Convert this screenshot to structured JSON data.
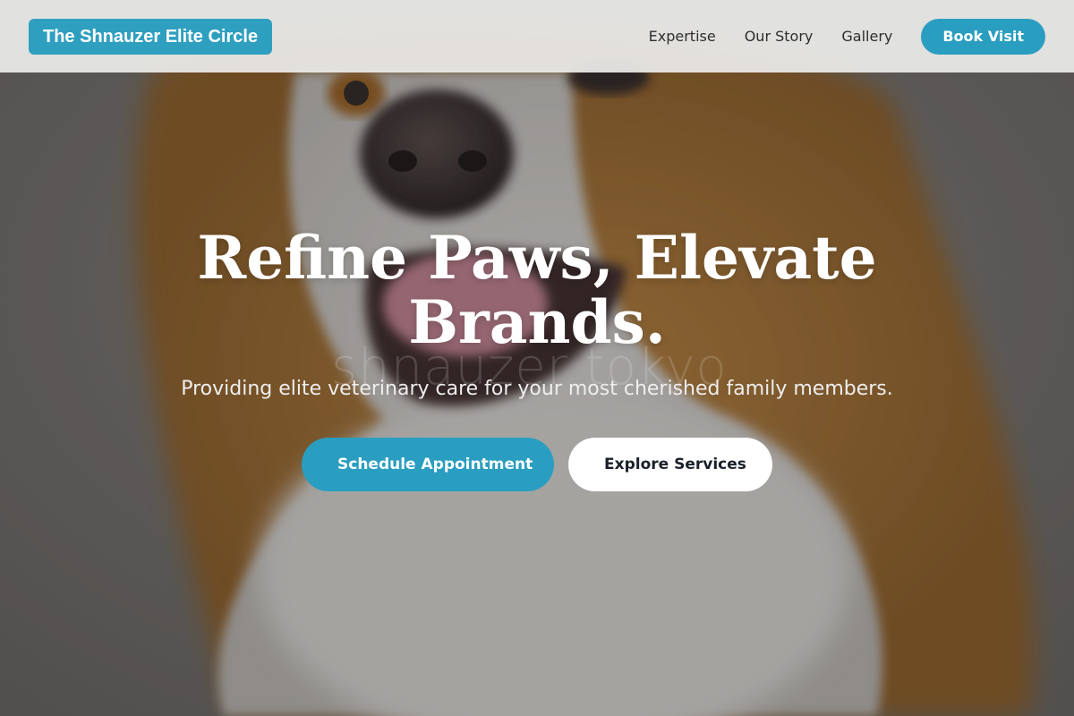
{
  "header": {
    "brand": "The Shnauzer Elite Circle",
    "nav": [
      {
        "label": "Expertise"
      },
      {
        "label": "Our Story"
      },
      {
        "label": "Gallery"
      }
    ],
    "cta": "Book Visit"
  },
  "hero": {
    "title": "Refine Paws, Elevate Brands.",
    "subtitle": "Providing elite veterinary care for your most cherished family members.",
    "primary_button": "Schedule Appointment",
    "secondary_button": "Explore Services",
    "background_watermark": "shnauzer tokyo",
    "background_image": "dog-portrait-photo"
  },
  "colors": {
    "accent": "#2a9ec0",
    "header_bg": "#ecece9",
    "primary_text_on_dark": "#ffffff",
    "secondary_button_text": "#1b1f2a"
  }
}
